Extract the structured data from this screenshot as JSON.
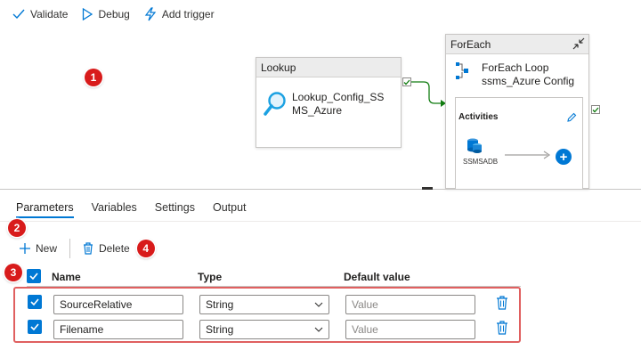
{
  "toolbar": {
    "validate_label": "Validate",
    "debug_label": "Debug",
    "add_trigger_label": "Add trigger"
  },
  "canvas": {
    "badge_1": "1",
    "lookup": {
      "header": "Lookup",
      "name_line1": "Lookup_Config_SS",
      "name_line2": "MS_Azure"
    },
    "foreach": {
      "header": "ForEach",
      "name_line1": "ForEach Loop",
      "name_line2": "ssms_Azure Config",
      "activities_title": "Activities",
      "inner_activity_label": "SSMSADB"
    }
  },
  "tabs": [
    {
      "label": "Parameters",
      "active": true
    },
    {
      "label": "Variables",
      "active": false
    },
    {
      "label": "Settings",
      "active": false
    },
    {
      "label": "Output",
      "active": false
    }
  ],
  "actions": {
    "badge_2": "2",
    "new_label": "New",
    "delete_label": "Delete",
    "badge_4": "4"
  },
  "table": {
    "badge_3": "3",
    "headers": {
      "name": "Name",
      "type": "Type",
      "default_value": "Default value"
    },
    "rows": [
      {
        "name": "SourceRelative",
        "type": "String",
        "default_placeholder": "Value",
        "checked": true
      },
      {
        "name": "Filename",
        "type": "String",
        "default_placeholder": "Value",
        "checked": true
      }
    ]
  },
  "colors": {
    "accent": "#0078d4",
    "badge_red": "#d81b1b",
    "highlight_border": "#e06060",
    "success_green": "#107c10"
  }
}
